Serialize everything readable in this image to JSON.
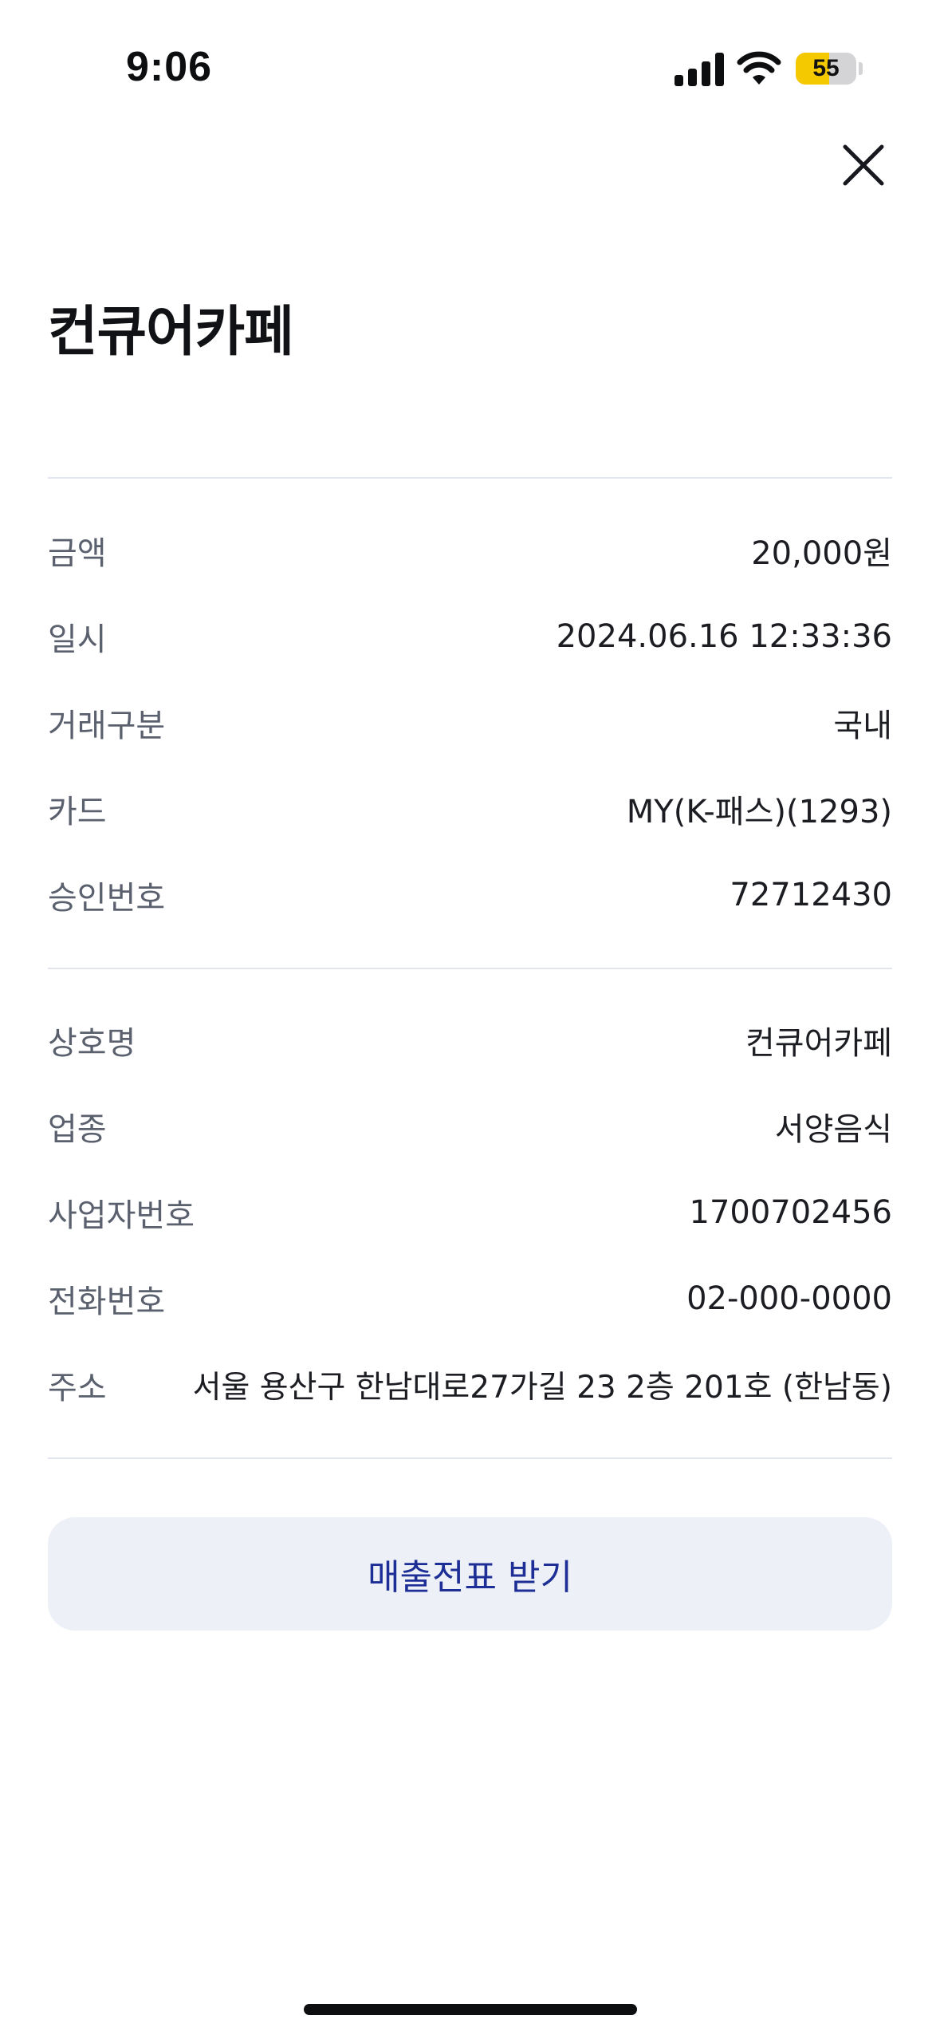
{
  "status_bar": {
    "time": "9:06",
    "battery_level": "55",
    "battery_color": "#f5c900"
  },
  "header": {
    "title": "컨큐어카페",
    "close_icon": "close-icon"
  },
  "transaction": [
    {
      "label": "금액",
      "value": "20,000원"
    },
    {
      "label": "일시",
      "value": "2024.06.16 12:33:36"
    },
    {
      "label": "거래구분",
      "value": "국내"
    },
    {
      "label": "카드",
      "value": "MY(K-패스)(1293)"
    },
    {
      "label": "승인번호",
      "value": "72712430"
    }
  ],
  "merchant": [
    {
      "label": "상호명",
      "value": "컨큐어카페"
    },
    {
      "label": "업종",
      "value": "서양음식"
    },
    {
      "label": "사업자번호",
      "value": "1700702456"
    },
    {
      "label": "전화번호",
      "value": "02-000-0000"
    },
    {
      "label": "주소",
      "value": "서울 용산구 한남대로27가길 23 2층 201호 (한남동)"
    }
  ],
  "actions": {
    "receipt_button": "매출전표 받기"
  },
  "colors": {
    "button_bg": "#edf0f6",
    "button_text": "#1d2f96",
    "label_text": "#5a606e",
    "divider": "#e2e5ee"
  }
}
